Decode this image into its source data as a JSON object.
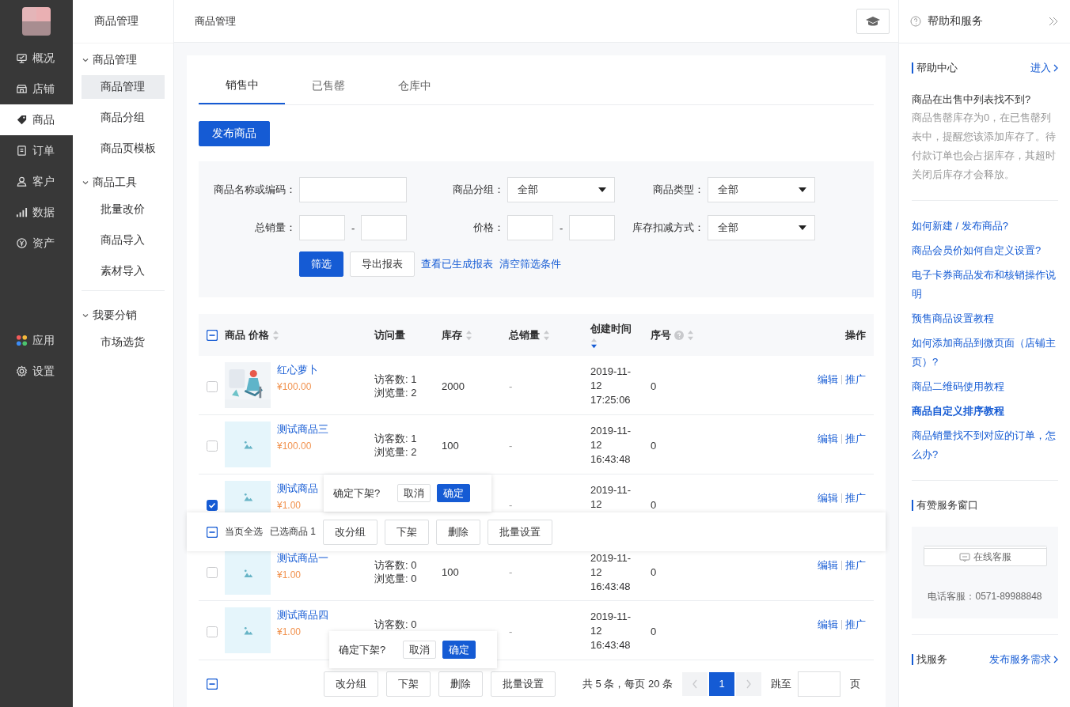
{
  "rail": {
    "items": [
      {
        "label": "概况",
        "selected": false
      },
      {
        "label": "店铺",
        "selected": false
      },
      {
        "label": "商品",
        "selected": true
      },
      {
        "label": "订单",
        "selected": false
      },
      {
        "label": "客户",
        "selected": false
      },
      {
        "label": "数据",
        "selected": false
      },
      {
        "label": "资产",
        "selected": false
      }
    ],
    "bottom_items": [
      {
        "label": "应用",
        "selected": false
      },
      {
        "label": "设置",
        "selected": false
      }
    ]
  },
  "subnav": {
    "title": "商品管理",
    "groups": [
      {
        "label": "商品管理",
        "expanded": true,
        "divider_before": false,
        "children": [
          {
            "label": "商品管理",
            "selected": true
          },
          {
            "label": "商品分组",
            "selected": false
          },
          {
            "label": "商品页模板",
            "selected": false
          }
        ]
      },
      {
        "label": "商品工具",
        "expanded": true,
        "divider_before": false,
        "children": [
          {
            "label": "批量改价",
            "selected": false
          },
          {
            "label": "商品导入",
            "selected": false
          },
          {
            "label": "素材导入",
            "selected": false
          }
        ]
      },
      {
        "label": "我要分销",
        "expanded": true,
        "divider_before": true,
        "children": [
          {
            "label": "市场选货",
            "selected": false
          }
        ]
      }
    ]
  },
  "header": {
    "title": "商品管理"
  },
  "tabs": [
    {
      "label": "销售中",
      "selected": true
    },
    {
      "label": "已售罄",
      "selected": false
    },
    {
      "label": "仓库中",
      "selected": false
    }
  ],
  "publish_button": "发布商品",
  "filters": [
    [
      {
        "label": "商品名称或编码：",
        "kind": "text"
      },
      {
        "label": "商品分组：",
        "kind": "select",
        "value": "全部"
      },
      {
        "label": "商品类型：",
        "kind": "select",
        "value": "全部"
      }
    ],
    [
      {
        "label": "总销量：",
        "kind": "range",
        "separator": "-"
      },
      {
        "label": "价格：",
        "kind": "range",
        "separator": "-"
      },
      {
        "label": "库存扣减方式：",
        "kind": "select",
        "value": "全部"
      }
    ]
  ],
  "filter_actions": [
    {
      "label": "筛选",
      "kind": "primary"
    },
    {
      "label": "导出报表",
      "kind": "button"
    },
    {
      "label": "查看已生成报表",
      "kind": "link"
    },
    {
      "label": "清空筛选条件",
      "kind": "link"
    }
  ],
  "table": {
    "header_checkbox": {
      "indeterminate": true
    },
    "columns": [
      {
        "label": "商品",
        "sortable": false,
        "help": false
      },
      {
        "label": "价格",
        "sortable": true,
        "sort_desc": false,
        "help": false
      },
      {
        "label": "访问量",
        "sortable": false,
        "help": false
      },
      {
        "label": "库存",
        "sortable": true,
        "sort_desc": false,
        "help": false
      },
      {
        "label": "总销量",
        "sortable": true,
        "sort_desc": false,
        "help": false
      },
      {
        "label": "创建时间",
        "sortable": true,
        "sort_desc": true,
        "help": false
      },
      {
        "label": "序号",
        "sortable": true,
        "sort_desc": false,
        "help": true
      },
      {
        "label": "操作",
        "sortable": false,
        "help": false
      }
    ],
    "rows": [
      {
        "checked": false,
        "kind": "illustration",
        "name": "红心萝卜",
        "price": "¥100.00",
        "visits": [
          "访客数: 1",
          "浏览量: 2"
        ],
        "stock": "2000",
        "sales": "-",
        "created": [
          "2019-11-",
          "12",
          "17:25:06"
        ],
        "order": "0",
        "actions": [
          "编辑",
          "推广"
        ]
      },
      {
        "checked": false,
        "kind": "placeholder",
        "name": "测试商品三",
        "price": "¥100.00",
        "visits": [
          "访客数: 1",
          "浏览量: 2"
        ],
        "stock": "100",
        "sales": "-",
        "created": [
          "2019-11-",
          "12",
          "16:43:48"
        ],
        "order": "0",
        "actions": [
          "编辑",
          "推广"
        ]
      },
      {
        "checked": true,
        "kind": "placeholder",
        "name": "测试商品",
        "price": "¥1.00",
        "visits": [],
        "sales": "-",
        "created": [
          "2019-11-",
          "12"
        ],
        "order": "0",
        "actions": [
          "编辑",
          "推广"
        ]
      },
      {
        "checked": false,
        "kind": "placeholder",
        "name": "测试商品一",
        "price": "¥1.00",
        "visits": [
          "访客数: 0",
          "浏览量: 0"
        ],
        "stock": "100",
        "sales": "-",
        "created": [
          "2019-11-",
          "12",
          "16:43:48"
        ],
        "order": "0",
        "actions": [
          "编辑",
          "推广"
        ]
      },
      {
        "checked": false,
        "kind": "placeholder",
        "name": "测试商品四",
        "price": "¥1.00",
        "visits": [
          "访客数: 0"
        ],
        "sales": "-",
        "created": [
          "2019-11-",
          "12",
          "16:43:48"
        ],
        "order": "0",
        "actions": [
          "编辑",
          "推广"
        ]
      }
    ]
  },
  "batch_bar": {
    "indeterminate": true,
    "select_all": "当页全选",
    "selected_count": "已选商品 1",
    "buttons": [
      "改分组",
      "下架",
      "删除",
      "批量设置"
    ]
  },
  "popconfirms": [
    {
      "text": "确定下架?",
      "cancel": "取消",
      "ok": "确定"
    },
    {
      "text": "确定下架?",
      "cancel": "取消",
      "ok": "确定"
    }
  ],
  "footer": {
    "indeterminate": true,
    "buttons": [
      "改分组",
      "下架",
      "删除",
      "批量设置"
    ],
    "total": "共 5 条，每页 20 条",
    "pages": [
      {
        "label": "1",
        "selected": true
      }
    ],
    "jump_label": "跳至",
    "page_suffix": "页"
  },
  "help_panel": {
    "title": "帮助和服务",
    "help_center": {
      "title": "帮助中心",
      "enter": "进入",
      "question": "商品在出售中列表找不到?",
      "answer": "商品售罄库存为0，在已售罄列表中，提醒您该添加库存了。待付款订单也会占据库存，其超时关闭后库存才会释放。",
      "links": [
        {
          "label": "如何新建 / 发布商品?",
          "bold": false
        },
        {
          "label": "商品会员价如何自定义设置?",
          "bold": false
        },
        {
          "label": "电子卡券商品发布和核销操作说明",
          "bold": false
        },
        {
          "label": "预售商品设置教程",
          "bold": false
        },
        {
          "label": "如何添加商品到微页面（店铺主页）?",
          "bold": false
        },
        {
          "label": "商品二维码使用教程",
          "bold": false
        },
        {
          "label": "商品自定义排序教程",
          "bold": true
        },
        {
          "label": "商品销量找不到对应的订单，怎么办?",
          "bold": false
        }
      ]
    },
    "service": {
      "title": "有赞服务窗口",
      "button": "在线客服",
      "phone": "电话客服：0571-89988848"
    },
    "find": {
      "title": "找服务",
      "link": "发布服务需求"
    }
  }
}
